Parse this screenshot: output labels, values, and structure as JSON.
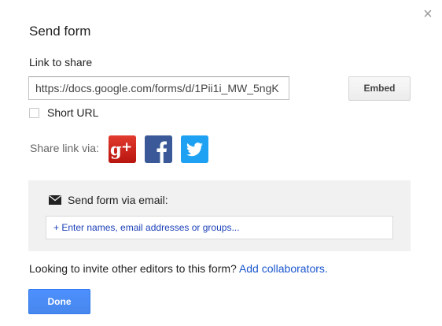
{
  "dialog": {
    "title": "Send form",
    "close_icon": "close-icon"
  },
  "link": {
    "label": "Link to share",
    "value": "https://docs.google.com/forms/d/1Pii1i_MW_5ngK",
    "embed_label": "Embed",
    "short_url_label": "Short URL",
    "short_url_checked": false
  },
  "share": {
    "label": "Share link via:",
    "services": [
      {
        "name": "Google+",
        "icon": "google-plus-icon",
        "color": "#d0201b"
      },
      {
        "name": "Facebook",
        "icon": "facebook-icon",
        "color": "#3b5998"
      },
      {
        "name": "Twitter",
        "icon": "twitter-icon",
        "color": "#1ea1f2"
      }
    ]
  },
  "email": {
    "icon": "envelope-icon",
    "label": "Send form via email:",
    "placeholder": "+ Enter names, email addresses or groups..."
  },
  "invite": {
    "text": "Looking to invite other editors to this form?",
    "link_label": "Add collaborators."
  },
  "footer": {
    "done_label": "Done"
  },
  "colors": {
    "accent": "#4d90fe",
    "link": "#1a56cc",
    "panel_bg": "#f1f1f1"
  }
}
